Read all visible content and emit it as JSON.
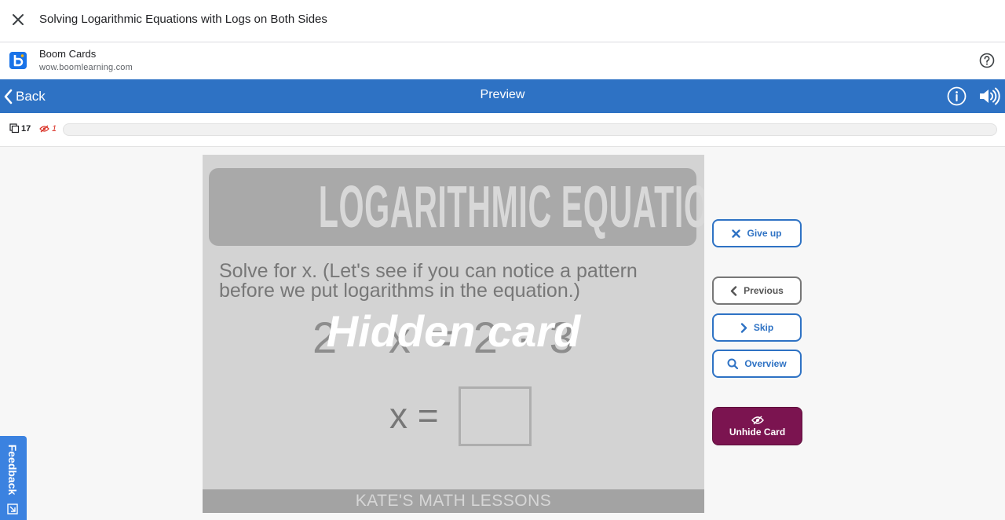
{
  "window": {
    "title": "Solving Logarithmic Equations with Logs on Both Sides"
  },
  "site": {
    "name": "Boom Cards",
    "url": "wow.boomlearning.com"
  },
  "appbar": {
    "back_label": "Back",
    "title": "Preview",
    "color": "#2e72c4"
  },
  "progress": {
    "cards_count": "17",
    "hidden_count": "1"
  },
  "card": {
    "heading": "LOGARITHMIC EQUATIONS",
    "instructions": "Solve for x.  (Let's see if you can notice a pattern before we put logarithms in the equation.)",
    "equation": "2 · x = 2 · 3",
    "hidden_overlay": "Hidden card",
    "answer_label": "x =",
    "answer_value": "",
    "footer": "KATE'S MATH LESSONS"
  },
  "buttons": {
    "give_up": "Give up",
    "previous": "Previous",
    "skip": "Skip",
    "overview": "Overview",
    "unhide": "Unhide Card"
  },
  "feedback": {
    "label": "Feedback"
  },
  "colors": {
    "accent": "#2e72c4",
    "unhide": "#7b1450",
    "hidden_marker": "#d93025",
    "feedback_tab": "#3b82e0"
  }
}
